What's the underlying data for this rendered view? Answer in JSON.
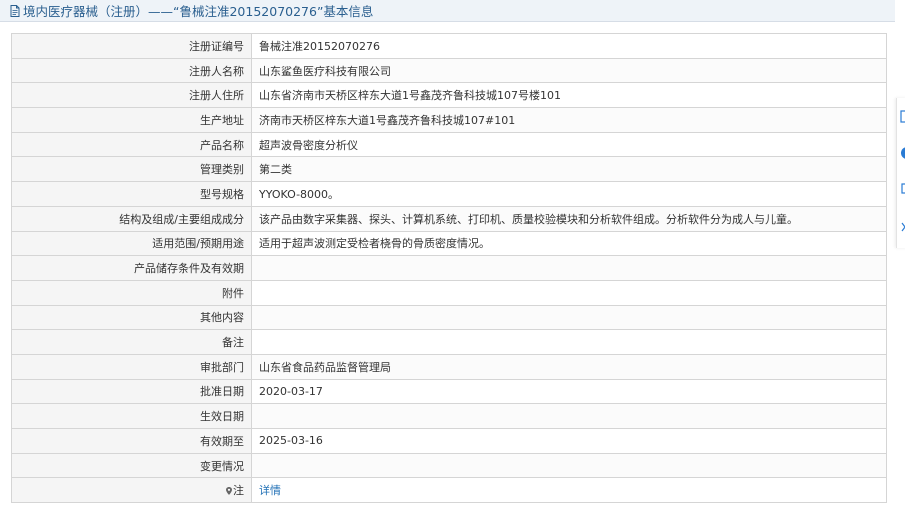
{
  "header": {
    "icon": "document-icon",
    "title": "境内医疗器械（注册）——“鲁械注准20152070276”基本信息"
  },
  "rows": [
    {
      "label": "注册证编号",
      "value": "鲁械注准20152070276"
    },
    {
      "label": "注册人名称",
      "value": "山东鲨鱼医疗科技有限公司"
    },
    {
      "label": "注册人住所",
      "value": "山东省济南市天桥区梓东大道1号鑫茂齐鲁科技城107号楼101"
    },
    {
      "label": "生产地址",
      "value": "济南市天桥区梓东大道1号鑫茂齐鲁科技城107#101"
    },
    {
      "label": "产品名称",
      "value": "超声波骨密度分析仪"
    },
    {
      "label": "管理类别",
      "value": "第二类"
    },
    {
      "label": "型号规格",
      "value": "YYOKO-8000。"
    },
    {
      "label": "结构及组成/主要组成成分",
      "value": "该产品由数字采集器、探头、计算机系统、打印机、质量校验模块和分析软件组成。分析软件分为成人与儿童。"
    },
    {
      "label": "适用范围/预期用途",
      "value": "适用于超声波测定受检者桡骨的骨质密度情况。"
    },
    {
      "label": "产品储存条件及有效期",
      "value": ""
    },
    {
      "label": "附件",
      "value": ""
    },
    {
      "label": "其他内容",
      "value": ""
    },
    {
      "label": "备注",
      "value": ""
    },
    {
      "label": "审批部门",
      "value": "山东省食品药品监督管理局"
    },
    {
      "label": "批准日期",
      "value": "2020-03-17"
    },
    {
      "label": "生效日期",
      "value": ""
    },
    {
      "label": "有效期至",
      "value": "2025-03-16"
    },
    {
      "label": "变更情况",
      "value": ""
    }
  ],
  "note_row": {
    "label": "注",
    "label_icon": "pin-icon",
    "link_text": "详情"
  },
  "sidebar": {
    "icons": [
      "document-icon",
      "info-icon",
      "share-icon",
      "close-icon"
    ]
  },
  "colors": {
    "header_bg": "#eef3f8",
    "header_text": "#2a5f8f",
    "label_bg": "#f5f5f5",
    "border": "#d5d5d5",
    "link": "#1f6fb5",
    "sidebar_accent": "#2a7bd4"
  }
}
